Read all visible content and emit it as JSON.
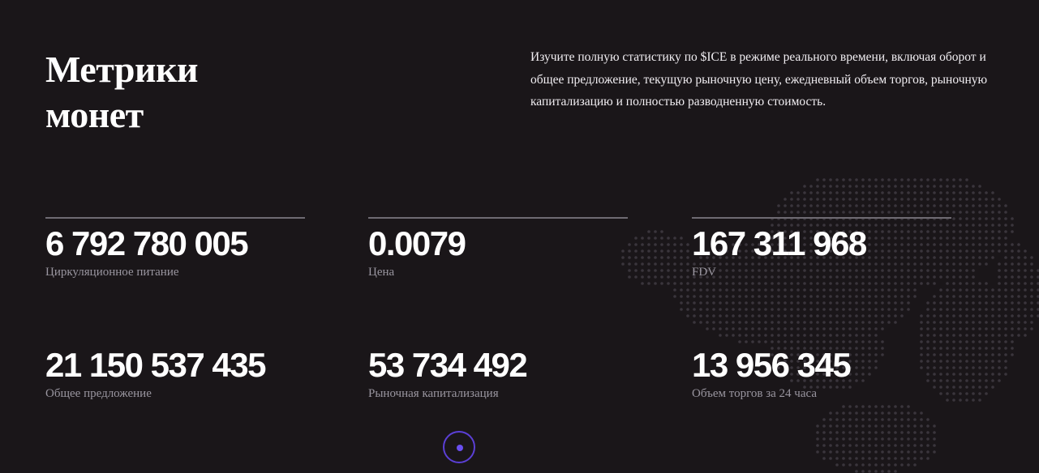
{
  "section": {
    "title_line1": "Метрики",
    "title_line2": "монет",
    "description": "Изучите полную статистику по $ICE в режиме реального времени, включая оборот и общее предложение, текущую рыночную цену, ежедневный объем торгов, рыночную капитализацию и полностью разводненную стоимость."
  },
  "metrics": [
    {
      "value": "6 792 780 005",
      "label": "Циркуляционное питание"
    },
    {
      "value": "0.0079",
      "label": "Цена"
    },
    {
      "value": "167 311 968",
      "label": "FDV"
    },
    {
      "value": "21 150 537 435",
      "label": "Общее предложение"
    },
    {
      "value": "53 734 492",
      "label": "Рыночная капитализация"
    },
    {
      "value": "13 956 345",
      "label": "Объем торгов за 24 часа"
    }
  ],
  "colors": {
    "background": "#1a1619",
    "accent": "#5b3fd6",
    "muted_text": "#9a96a0",
    "rule": "#6e6a72"
  },
  "icons": {
    "background_art": "dotted-world-map",
    "carousel": "carousel-dot-icon"
  }
}
